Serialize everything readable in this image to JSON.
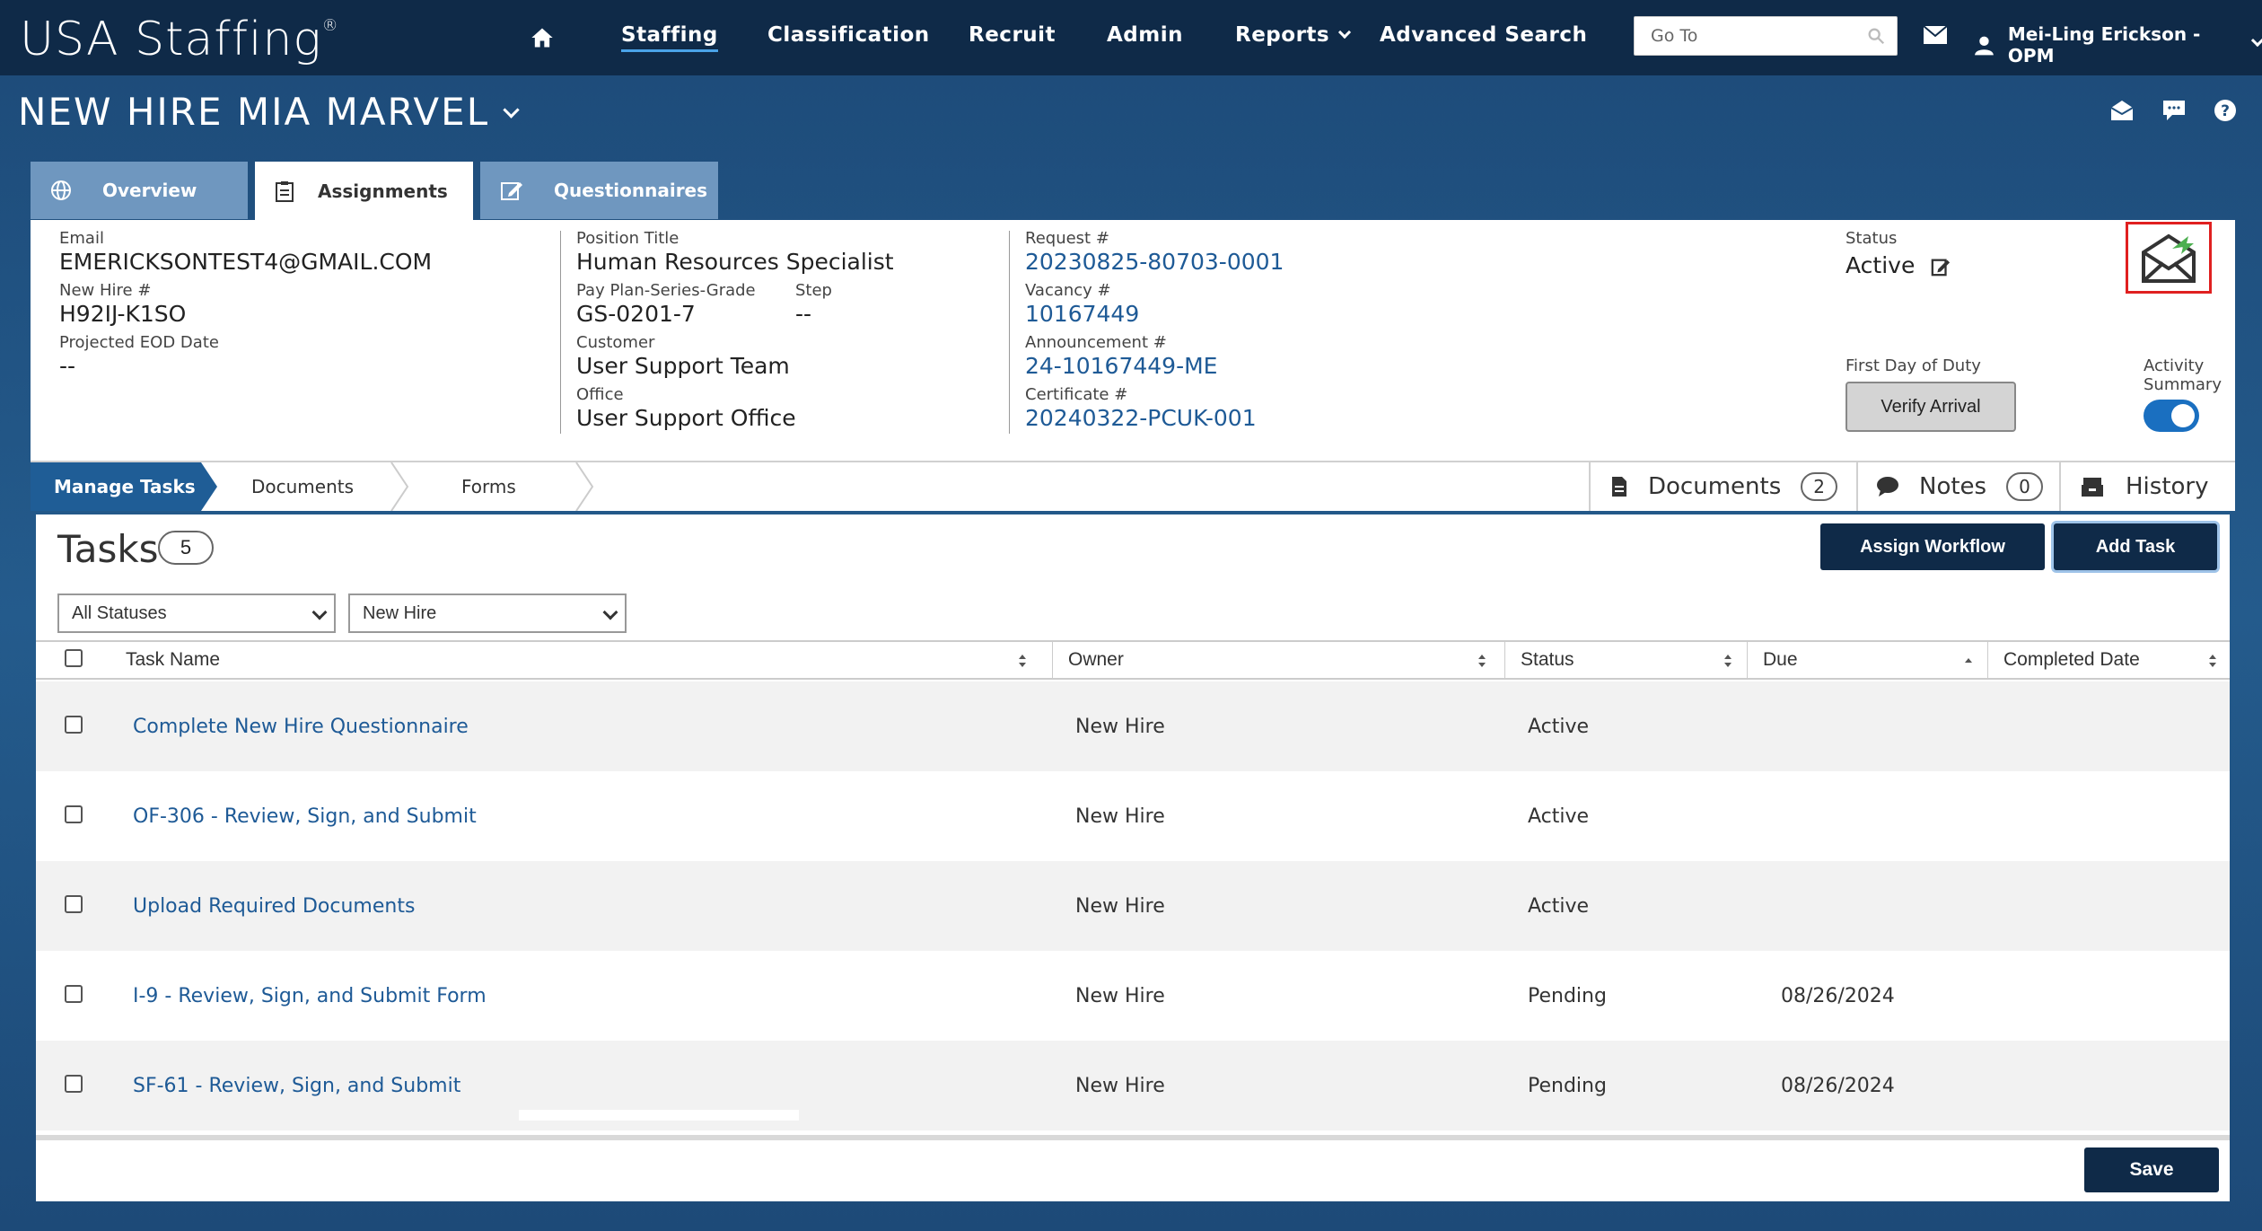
{
  "app": {
    "logo": "USA Staffing",
    "logo_mark": "®"
  },
  "nav": {
    "items": [
      "Staffing",
      "Classification",
      "Recruit",
      "Admin",
      "Reports",
      "Advanced Search"
    ],
    "goto_placeholder": "Go To",
    "user": "Mei-Ling Erickson - OPM"
  },
  "page": {
    "title": "NEW HIRE MIA MARVEL"
  },
  "tabs": [
    {
      "label": "Overview",
      "icon": "globe-icon"
    },
    {
      "label": "Assignments",
      "icon": "clipboard-icon"
    },
    {
      "label": "Questionnaires",
      "icon": "edit-icon"
    }
  ],
  "info": {
    "email_label": "Email",
    "email": "EMERICKSONTEST4@GMAIL.COM",
    "newhire_label": "New Hire #",
    "newhire": "H92IJ-K1SO",
    "eod_label": "Projected EOD Date",
    "eod": "--",
    "position_label": "Position Title",
    "position": "Human Resources Specialist",
    "ppsg_label": "Pay Plan-Series-Grade",
    "ppsg": "GS-0201-7",
    "step_label": "Step",
    "step": "--",
    "customer_label": "Customer",
    "customer": "User Support Team",
    "office_label": "Office",
    "office": "User Support Office",
    "request_label": "Request #",
    "request": "20230825-80703-0001",
    "vacancy_label": "Vacancy #",
    "vacancy": "10167449",
    "announcement_label": "Announcement #",
    "announcement": "24-10167449-ME",
    "certificate_label": "Certificate #",
    "certificate": "20240322-PCUK-001",
    "status_label": "Status",
    "status": "Active",
    "fdod_label": "First Day of Duty",
    "verify_label": "Verify Arrival",
    "activity_label_1": "Activity",
    "activity_label_2": "Summary"
  },
  "subnav": {
    "crumbs": [
      "Manage Tasks",
      "Documents",
      "Forms"
    ],
    "documents_label": "Documents",
    "documents_count": "2",
    "notes_label": "Notes",
    "notes_count": "0",
    "history_label": "History"
  },
  "tasks": {
    "title": "Tasks",
    "count": "5",
    "assign_workflow": "Assign Workflow",
    "add_task": "Add Task",
    "filter_status": "All Statuses",
    "filter_owner": "New Hire",
    "columns": [
      "Task Name",
      "Owner",
      "Status",
      "Due",
      "Completed Date"
    ],
    "rows": [
      {
        "name": "Complete New Hire Questionnaire",
        "owner": "New Hire",
        "status": "Active",
        "due": "",
        "completed": ""
      },
      {
        "name": "OF-306 - Review, Sign, and Submit",
        "owner": "New Hire",
        "status": "Active",
        "due": "",
        "completed": ""
      },
      {
        "name": "Upload Required Documents",
        "owner": "New Hire",
        "status": "Active",
        "due": "",
        "completed": ""
      },
      {
        "name": "I-9 - Review, Sign, and Submit Form",
        "owner": "New Hire",
        "status": "Pending",
        "due": "08/26/2024",
        "completed": ""
      },
      {
        "name": "SF-61 - Review, Sign, and Submit",
        "owner": "New Hire",
        "status": "Pending",
        "due": "08/26/2024",
        "completed": ""
      }
    ]
  },
  "footer": {
    "save": "Save"
  },
  "colors": {
    "nav_bg": "#0f2a48",
    "page_bg": "#1f4f7d",
    "link": "#1e5a96",
    "toggle": "#1a6fc0",
    "highlight_border": "#e02020"
  }
}
